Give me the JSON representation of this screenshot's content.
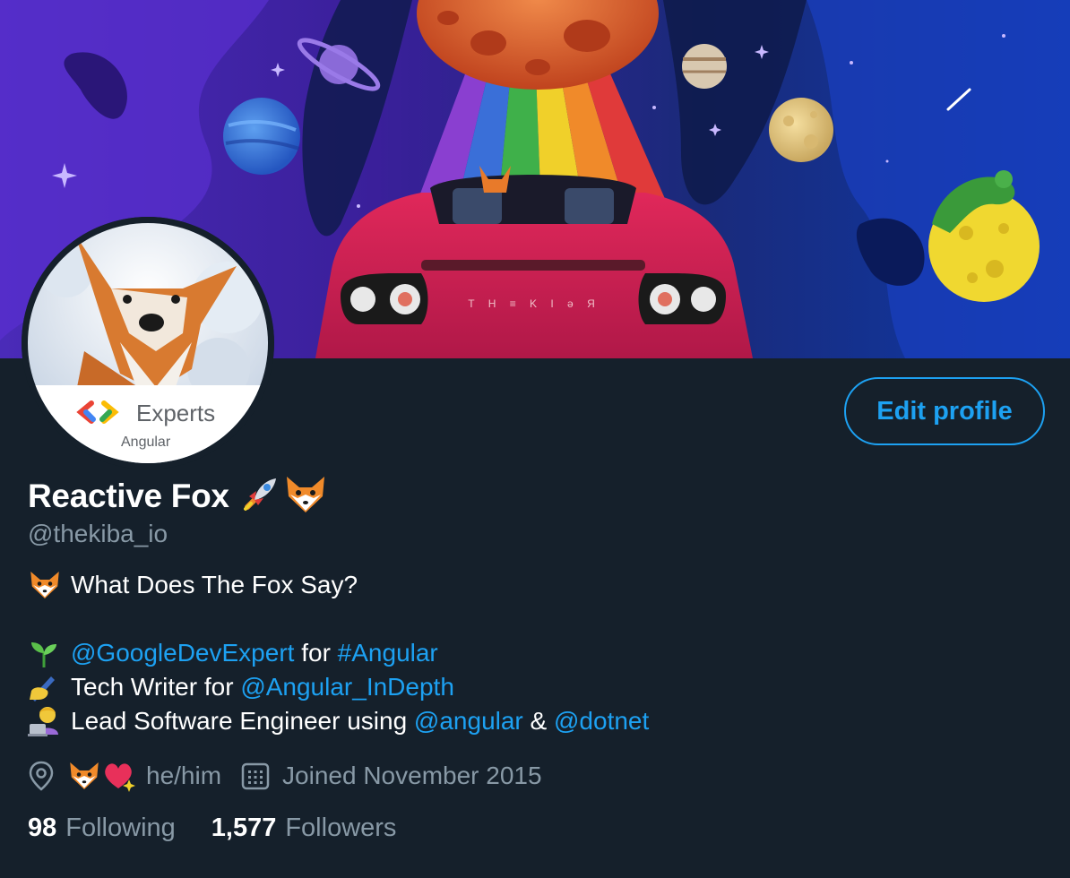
{
  "profile": {
    "name": "Reactive Fox",
    "handle": "@thekiba_io",
    "edit_label": "Edit profile",
    "avatar_badge": {
      "title": "Experts",
      "subtitle": "Angular"
    },
    "banner_plate": "T H ≡ K I ə Я"
  },
  "bio": {
    "line1": "What Does The Fox Say?",
    "line2": {
      "mention": "@GoogleDevExpert",
      "text": " for ",
      "hashtag": "#Angular"
    },
    "line3": {
      "text": "Tech Writer for ",
      "mention": "@Angular_InDepth"
    },
    "line4": {
      "text": "Lead Software Engineer using ",
      "mention1": "@angular",
      "amp": " & ",
      "mention2": "@dotnet"
    }
  },
  "meta": {
    "pronouns": "he/him",
    "joined": "Joined November 2015"
  },
  "stats": {
    "following_count": "98",
    "following_label": "Following",
    "followers_count": "1,577",
    "followers_label": "Followers"
  },
  "icons": {
    "location": "location-pin-icon",
    "calendar": "calendar-icon",
    "rocket": "rocket-emoji",
    "fox": "fox-emoji",
    "heart": "sparkling-heart-emoji",
    "seedling": "seedling-emoji",
    "writing": "writing-hand-emoji",
    "technologist": "technologist-emoji"
  },
  "colors": {
    "background": "#15202b",
    "accent": "#1da1f2",
    "secondary_text": "#8899a6"
  }
}
